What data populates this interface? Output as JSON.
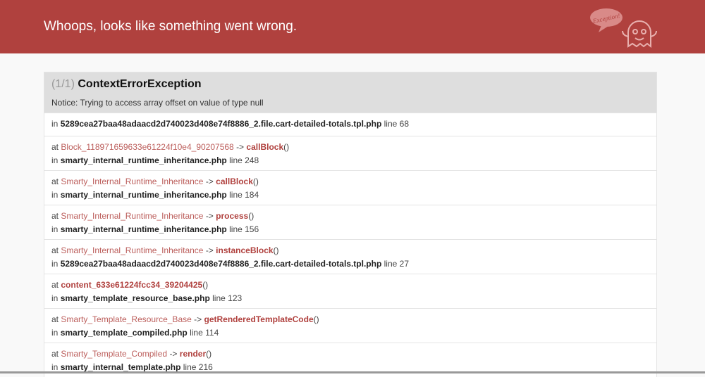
{
  "header": {
    "title": "Whoops, looks like something went wrong.",
    "mascot_text": "Exception!"
  },
  "exception": {
    "count": "(1/1)",
    "name": "ContextErrorException",
    "message": "Notice: Trying to access array offset on value of type null"
  },
  "first": {
    "file": "5289cea27baa48adaacd2d740023d408e74f8886_2.file.cart-detailed-totals.tpl.php",
    "line": "line 68"
  },
  "frames": [
    {
      "cls": "Block_118971659633e61224f10e4_90207568",
      "arrow": "->",
      "fn": "callBlock",
      "file": "smarty_internal_runtime_inheritance.php",
      "line": "line 248"
    },
    {
      "cls": "Smarty_Internal_Runtime_Inheritance",
      "arrow": "->",
      "fn": "callBlock",
      "file": "smarty_internal_runtime_inheritance.php",
      "line": "line 184"
    },
    {
      "cls": "Smarty_Internal_Runtime_Inheritance",
      "arrow": "->",
      "fn": "process",
      "file": "smarty_internal_runtime_inheritance.php",
      "line": "line 156"
    },
    {
      "cls": "Smarty_Internal_Runtime_Inheritance",
      "arrow": "->",
      "fn": "instanceBlock",
      "file": "5289cea27baa48adaacd2d740023d408e74f8886_2.file.cart-detailed-totals.tpl.php",
      "line": "line 27"
    },
    {
      "cls": "",
      "arrow": "",
      "fn": "content_633e61224fcc34_39204425",
      "file": "smarty_template_resource_base.php",
      "line": "line 123"
    },
    {
      "cls": "Smarty_Template_Resource_Base",
      "arrow": "->",
      "fn": "getRenderedTemplateCode",
      "file": "smarty_template_compiled.php",
      "line": "line 114"
    },
    {
      "cls": "Smarty_Template_Compiled",
      "arrow": "->",
      "fn": "render",
      "file": "smarty_internal_template.php",
      "line": "line 216"
    }
  ],
  "labels": {
    "at": "at",
    "in": "in",
    "parens": "()"
  }
}
